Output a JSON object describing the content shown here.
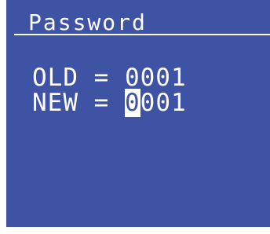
{
  "screen": {
    "title": "Password",
    "old_line": "OLD = 0001",
    "new_prefix": "NEW = ",
    "new_cursor_digit": "0",
    "new_rest": "001",
    "colors": {
      "background": "#3f53a4",
      "text": "#ffffff"
    }
  }
}
